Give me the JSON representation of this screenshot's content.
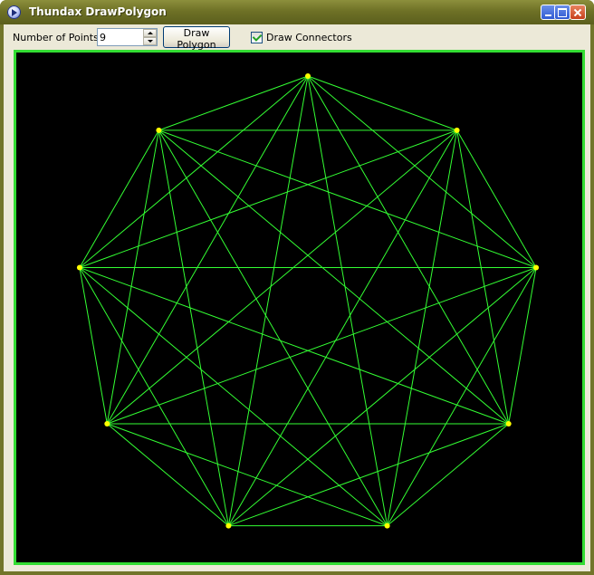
{
  "window": {
    "title": "Thundax DrawPolygon",
    "controls": {
      "minimize": "minimize-icon",
      "maximize": "maximize-icon",
      "close": "close-icon"
    }
  },
  "toolbar": {
    "points_label": "Number of Points:",
    "points_value": "9",
    "draw_button_label": "Draw Polygon",
    "connectors_label": "Draw Connectors",
    "connectors_checked": true
  },
  "canvas": {
    "background": "#000000",
    "border_color": "#33dd33",
    "line_color": "#33ff33",
    "vertex_color": "#ffff00",
    "vertex_count": 9,
    "draw_connectors": true
  }
}
